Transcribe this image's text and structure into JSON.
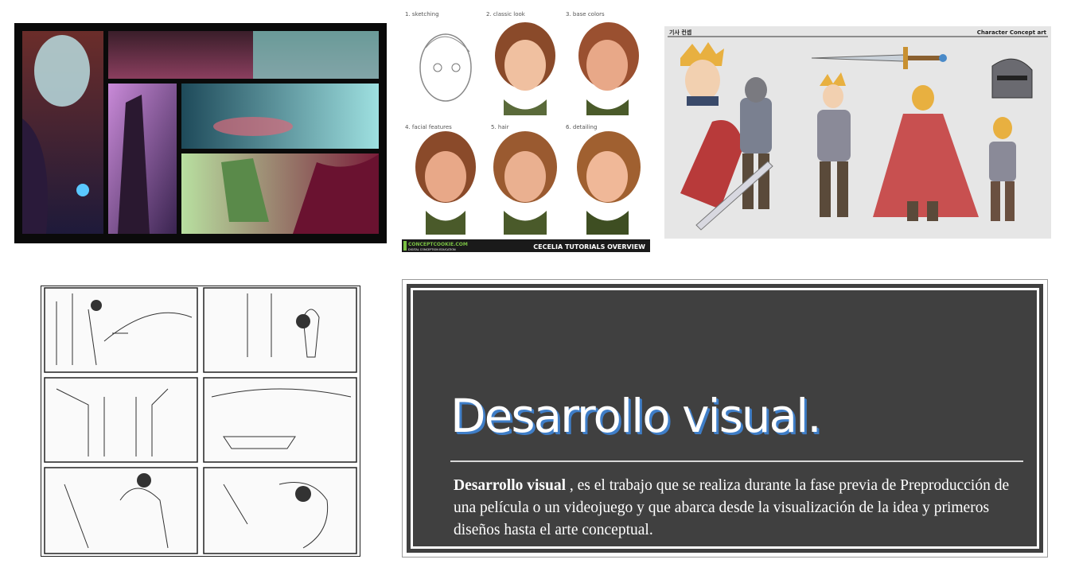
{
  "images": {
    "environment_concept": {
      "alt": "environment concept art panels"
    },
    "tutorial": {
      "steps": [
        "1. sketching",
        "2. classic look",
        "3. base colors",
        "4. facial features",
        "5. hair",
        "6. detailing"
      ],
      "footer_brand": "CONCEPTCOOKIE.COM",
      "footer_sub": "DIGITAL CONCEPTION EDUCATION",
      "footer_title": "CECELIA TUTORIALS OVERVIEW"
    },
    "character_sheet": {
      "header_left": "기사 컨셉",
      "header_right": "Character Concept art"
    },
    "storyboard": {
      "alt": "black and white storyboard panels"
    }
  },
  "card": {
    "title": "Desarrollo visual.",
    "body_bold": "Desarrollo visual",
    "body_text": " , es el trabajo que se realiza durante la fase previa de Preproducción de una película o un videojuego y que abarca desde la visualización de la idea y primeros diseños hasta el arte conceptual."
  },
  "colors": {
    "card_bg": "#404040",
    "title_shadow": "#3f7ec8",
    "tutorial_footer_bg": "#1a1a1a",
    "tutorial_footer_accent": "#7ac143"
  }
}
